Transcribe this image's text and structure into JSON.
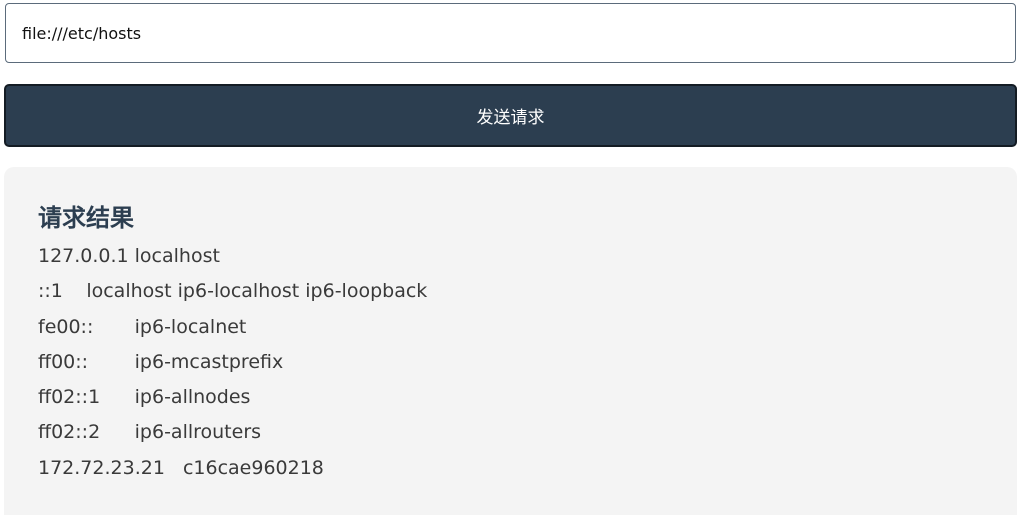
{
  "request": {
    "url_value": "file:///etc/hosts",
    "send_label": "发送请求"
  },
  "result": {
    "title": "请求结果",
    "lines": [
      "127.0.0.1\tlocalhost",
      "::1\tlocalhost ip6-localhost ip6-loopback",
      "fe00::\tip6-localnet",
      "ff00::\tip6-mcastprefix",
      "ff02::1\tip6-allnodes",
      "ff02::2\tip6-allrouters",
      "172.72.23.21\tc16cae960218"
    ]
  }
}
